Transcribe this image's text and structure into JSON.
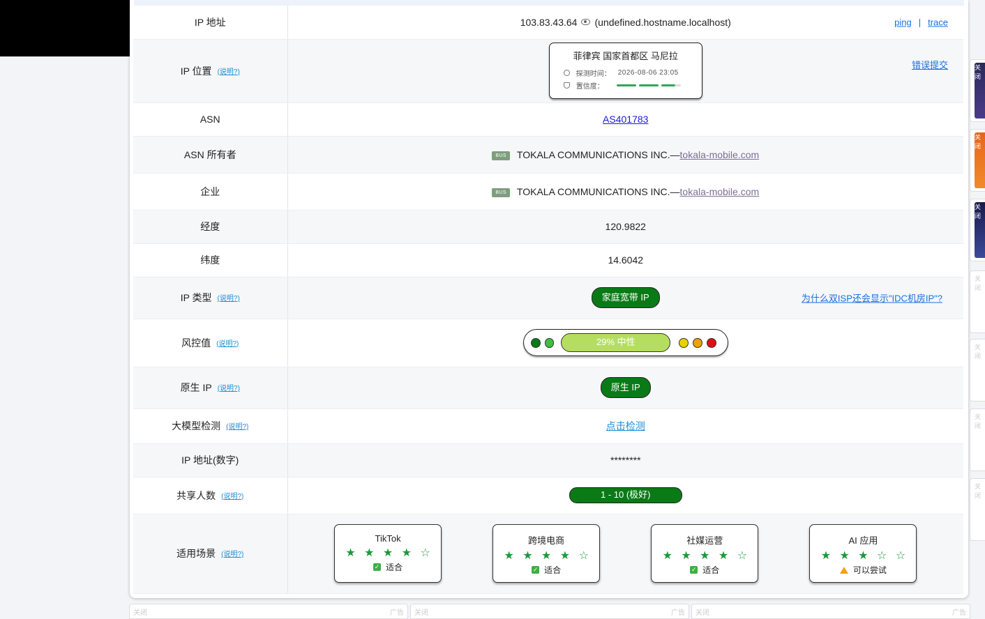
{
  "rows": {
    "ip": {
      "label": "IP 地址",
      "value": "103.83.43.64",
      "hostname": "(undefined.hostname.localhost)",
      "ping": "ping",
      "separator": "|",
      "trace": "trace"
    },
    "location": {
      "label": "IP 位置",
      "help": "(说明?)",
      "place": "菲律宾 国家首都区 马尼拉",
      "detect_label": "探测时间：",
      "detect_time": "2026-08-06 23:05",
      "confidence_label": "置信度：",
      "confidence": 0.9,
      "report": "错误提交"
    },
    "asn": {
      "label": "ASN",
      "value": "AS401783"
    },
    "asn_owner": {
      "label": "ASN 所有者",
      "badge": "BUS",
      "name": "TOKALA COMMUNICATIONS INC.—",
      "domain": "tokala-mobile.com"
    },
    "company": {
      "label": "企业",
      "badge": "BUS",
      "name": "TOKALA COMMUNICATIONS INC.—",
      "domain": "tokala-mobile.com"
    },
    "longitude": {
      "label": "经度",
      "value": "120.9822"
    },
    "latitude": {
      "label": "纬度",
      "value": "14.6042"
    },
    "ip_type": {
      "label": "IP 类型",
      "help": "(说明?)",
      "value": "家庭宽带 IP",
      "faq": "为什么双ISP还会显示\"IDC机房IP\"?"
    },
    "risk": {
      "label": "风控值",
      "help": "(说明?)",
      "value": "29%  中性",
      "percent": 29,
      "colors": {
        "dot1": "#0a7a16",
        "dot2": "#3cc13c",
        "bar": "#b5de61",
        "dot3": "#e6d200",
        "dot4": "#f0a000",
        "dot5": "#e01010"
      }
    },
    "native": {
      "label": "原生 IP",
      "help": "(说明?)",
      "value": "原生 IP"
    },
    "llm": {
      "label": "大模型检测",
      "help": "(说明?)",
      "value": "点击检测"
    },
    "ip_numeric": {
      "label": "IP 地址(数字)",
      "value": "********"
    },
    "sharing": {
      "label": "共享人数",
      "help": "(说明?)",
      "value": "1 - 10 (极好)"
    },
    "scenarios": {
      "label": "适用场景",
      "help": "(说明?)",
      "items": [
        {
          "name": "TikTok",
          "stars": "★ ★ ★ ★ ☆",
          "rating": 4,
          "verdict": "适合",
          "icon": "check-icon"
        },
        {
          "name": "跨境电商",
          "stars": "★ ★ ★ ★ ☆",
          "rating": 4,
          "verdict": "适合",
          "icon": "check-icon"
        },
        {
          "name": "社媒运营",
          "stars": "★ ★ ★ ★ ☆",
          "rating": 4,
          "verdict": "适合",
          "icon": "check-icon"
        },
        {
          "name": "AI 应用",
          "stars": "★ ★ ★ ☆ ☆",
          "rating": 3,
          "verdict": "可以尝试",
          "icon": "warning-icon"
        }
      ]
    }
  },
  "ads": {
    "close": "关闭",
    "ad": "广告"
  },
  "colors": {
    "green": "#0a7a16",
    "link": "#1a6fe0",
    "help": "#1a8fd6"
  }
}
